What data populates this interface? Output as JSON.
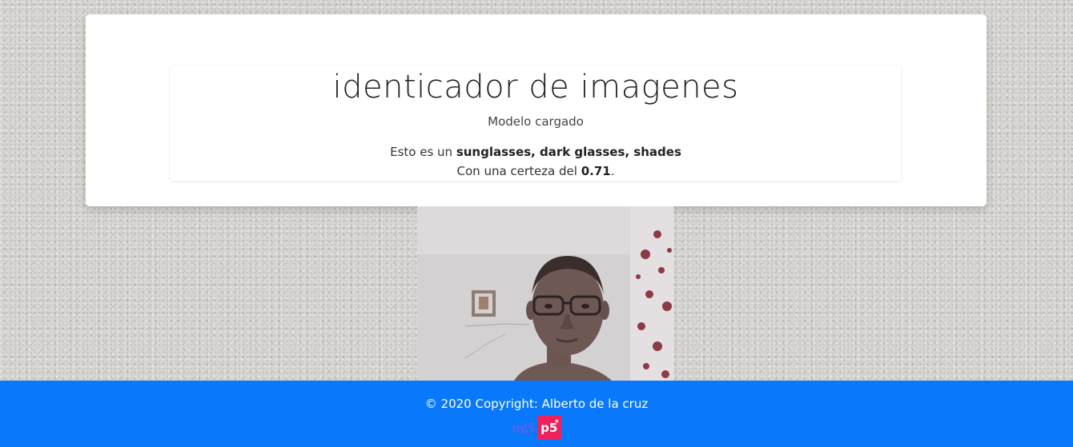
{
  "header": {
    "title": "identicador de imagenes",
    "status": "Modelo cargado"
  },
  "result": {
    "prefix": "Esto es un ",
    "label": "sunglasses, dark glasses, shades",
    "certainty_prefix": "Con una certeza del ",
    "certainty_value": "0.71",
    "certainty_suffix": "."
  },
  "camera": {
    "icon": "webcam-video-feed"
  },
  "footer": {
    "copyright": "© 2020 Copyright: Alberto de la cruz",
    "ml5_logo": "ml5",
    "p5_logo": "p5",
    "p5_mark": "*",
    "accent_color": "#0a78fa",
    "p5_color": "#ed225d"
  }
}
